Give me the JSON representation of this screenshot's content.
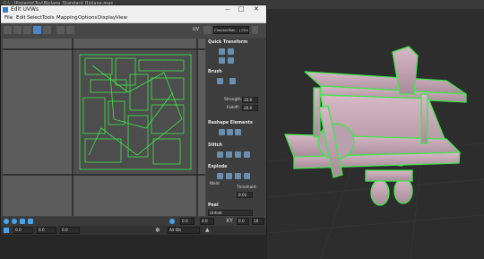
{
  "host": {
    "title_fragment": "C:\\...\\Projects\\Toy\\Biplane_Standard_Biplane.max"
  },
  "window": {
    "title": "Edit UVWs"
  },
  "menu": [
    "File",
    "Edit",
    "Select",
    "Tools",
    "Mapping",
    "Options",
    "Display",
    "View"
  ],
  "toolbar": {
    "uv_label": "UV",
    "checker_label": "CheckerPatt... ( Checker )"
  },
  "panel": {
    "quick_transform": "Quick Transform",
    "brush": "Brush",
    "strength_label": "Strength:",
    "strength_value": "10.0",
    "falloff_label": "Falloff:",
    "falloff_value": "20.0",
    "reshape": "Reshape Elements",
    "stitch": "Stitch",
    "explode": "Explode",
    "weld": "Weld",
    "threshold_label": "Threshold:",
    "threshold_value": "0.01",
    "peel": "Peel",
    "unfold_label": "Unfold"
  },
  "bottom": {
    "u_value": "0.0",
    "v_value": "0.0",
    "w_value": "0.0",
    "xy_label": "XY",
    "uv_label": "UV",
    "zoom_value": "16",
    "all_ids": "All IDs"
  },
  "colors": {
    "uv_edge": "#3fe84a",
    "model": "#c7a7b6",
    "accent": "#4aa3e8"
  }
}
